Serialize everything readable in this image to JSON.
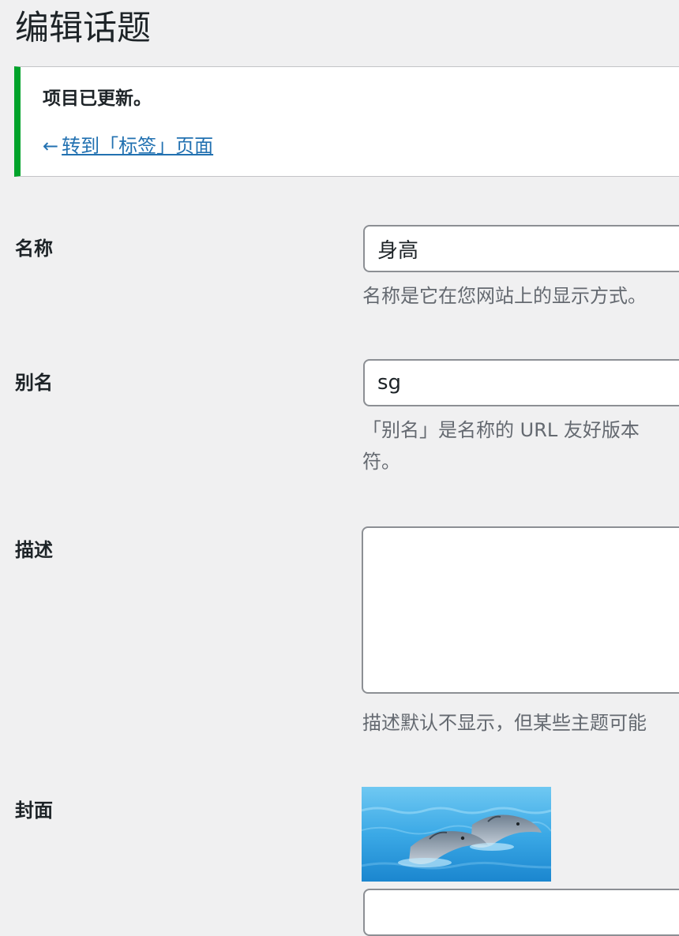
{
  "page": {
    "title": "编辑话题"
  },
  "notice": {
    "message": "项目已更新。",
    "back_arrow": "←",
    "back_link": "转到「标签」页面",
    "accent_color": "#00a32a"
  },
  "form": {
    "name": {
      "label": "名称",
      "value": "身高",
      "help": "名称是它在您网站上的显示方式。"
    },
    "slug": {
      "label": "别名",
      "value": "sg",
      "help_line1": "「别名」是名称的 URL 友好版本",
      "help_line2": "符。"
    },
    "description": {
      "label": "描述",
      "value": "",
      "help": "描述默认不显示，但某些主题可能"
    },
    "cover": {
      "label": "封面",
      "image": "dolphins-photo"
    }
  },
  "colors": {
    "background": "#f0f0f1",
    "link": "#2271b1",
    "help_text": "#646970",
    "input_border": "#8c8f94"
  }
}
